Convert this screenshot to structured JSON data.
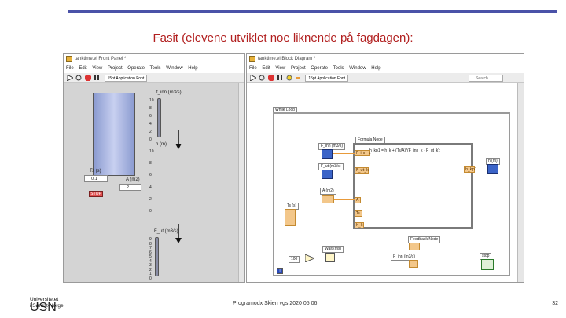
{
  "slide": {
    "title": "Fasit (elevene utviklet noe liknende på fagdagen):",
    "footer": "Programodx Skien vgs 2020 05 06",
    "page_number": "32",
    "logo_text": "USN",
    "logo_subtext_line1": "Universitetet",
    "logo_subtext_line2": "i Sørøst-Norge"
  },
  "front_panel": {
    "window_title": "tanktime.vi Front Panel *",
    "menu": [
      "File",
      "Edit",
      "View",
      "Project",
      "Operate",
      "Tools",
      "Window",
      "Help"
    ],
    "font_selector": "15pt Application Font",
    "labels": {
      "f_inn": "f_inn (m3/s)",
      "h": "h (m)",
      "f_ut": "F_ut (m3/s)",
      "ts": "Ts (s)",
      "a": "A (m2)",
      "stop": "STOP"
    },
    "ts_value": "0,1",
    "a_value": "2",
    "f_inn_ticks": [
      "10",
      "8",
      "6",
      "4",
      "2",
      "0"
    ],
    "h_ticks": [
      "10",
      "8",
      "6",
      "4",
      "2",
      "0"
    ],
    "f_ut_ticks": [
      "9",
      "8",
      "7",
      "6",
      "5",
      "4",
      "3",
      "2",
      "1",
      "0"
    ]
  },
  "block_diagram": {
    "window_title": "tanktime.vi Block Diagram *",
    "menu": [
      "File",
      "Edit",
      "View",
      "Project",
      "Operate",
      "Tools",
      "Window",
      "Help"
    ],
    "font_selector": "15pt Application Font",
    "search_placeholder": "Search",
    "labels": {
      "while_loop": "While Loop",
      "formula_node": "Formula Node",
      "formula": "h_kp1 = h_k + (Ts/A)*(F_inn_k - F_ut_k);",
      "f_inn": "F_inn (m3/s)",
      "f_ut": "F_ut (m3/s)",
      "a": "A (m2)",
      "ts": "Ts (s)",
      "h": "h (m)",
      "feedback": "Feedback Node",
      "wait": "Wait (ms)",
      "f_inn_out": "F_inn (m3/s)",
      "stop": "stop",
      "hundred": "100",
      "i": "i"
    },
    "wire_tags": {
      "f_inn_k": "F_inn_k",
      "f_ut_k": "F_ut_k",
      "a": "A",
      "ts": "Ts",
      "h_k": "h_k",
      "h_kp1": "h_kp1"
    }
  }
}
